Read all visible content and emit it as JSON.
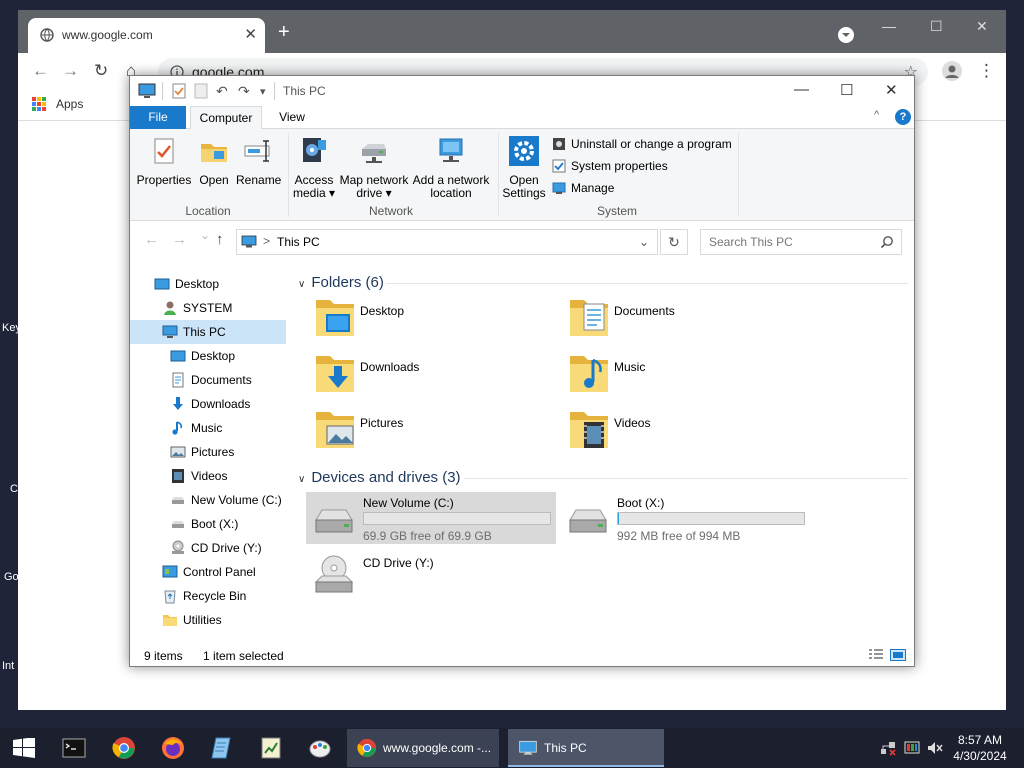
{
  "desktop": {
    "edge_labels": [
      "Key",
      "C",
      "Go",
      "Int"
    ]
  },
  "chrome": {
    "tab_title": "www.google.com",
    "close_tab": "✕",
    "new_tab": "+",
    "url": "google.com",
    "bookmark_apps": "Apps",
    "minimize": "—",
    "maximize": "☐",
    "close": "✕",
    "back": "←",
    "forward": "→",
    "reload": "↻",
    "home": "⌂",
    "star": "☆",
    "menu": "⋮"
  },
  "explorer": {
    "title": "This PC",
    "quick_undo": "↶",
    "quick_redo": "↷",
    "quick_dropdown": "▾",
    "minimize": "—",
    "maximize": "☐",
    "close": "✕",
    "tabs": {
      "file": "File",
      "computer": "Computer",
      "view": "View"
    },
    "ribbon_collapse": "^",
    "help": "?",
    "ribbon": {
      "location": {
        "label": "Location",
        "buttons": [
          "Properties",
          "Open",
          "Rename"
        ]
      },
      "network": {
        "label": "Network",
        "access_media": [
          "Access",
          "media ▾"
        ],
        "map_drive": [
          "Map network",
          "drive ▾"
        ],
        "add_location": [
          "Add a network",
          "location"
        ]
      },
      "system": {
        "label": "System",
        "open_settings": [
          "Open",
          "Settings"
        ],
        "uninstall": "Uninstall or change a program",
        "system_properties": "System properties",
        "manage": "Manage"
      }
    },
    "address": {
      "back": "←",
      "forward": "→",
      "recent": "⌄",
      "up": "↑",
      "separator": ">",
      "path": "This PC",
      "dropdown": "⌄",
      "refresh": "↻",
      "search_placeholder": "Search This PC"
    },
    "nav": [
      {
        "label": "Desktop",
        "icon": "desktop-icon"
      },
      {
        "label": "SYSTEM",
        "icon": "user-icon"
      },
      {
        "label": "This PC",
        "icon": "computer-icon",
        "selected": true
      },
      {
        "label": "Desktop",
        "icon": "desktop-icon"
      },
      {
        "label": "Documents",
        "icon": "documents-icon"
      },
      {
        "label": "Downloads",
        "icon": "downloads-icon"
      },
      {
        "label": "Music",
        "icon": "music-icon"
      },
      {
        "label": "Pictures",
        "icon": "pictures-icon"
      },
      {
        "label": "Videos",
        "icon": "videos-icon"
      },
      {
        "label": "New Volume (C:)",
        "icon": "drive-icon"
      },
      {
        "label": "Boot (X:)",
        "icon": "drive-icon"
      },
      {
        "label": "CD Drive (Y:)",
        "icon": "cd-drive-icon"
      },
      {
        "label": "Control Panel",
        "icon": "control-panel-icon"
      },
      {
        "label": "Recycle Bin",
        "icon": "recycle-bin-icon"
      },
      {
        "label": "Utilities",
        "icon": "folder-icon"
      }
    ],
    "folders_header": "Folders (6)",
    "folders": [
      {
        "label": "Desktop",
        "icon": "desktop-folder-icon"
      },
      {
        "label": "Documents",
        "icon": "documents-folder-icon"
      },
      {
        "label": "Downloads",
        "icon": "downloads-folder-icon"
      },
      {
        "label": "Music",
        "icon": "music-folder-icon"
      },
      {
        "label": "Pictures",
        "icon": "pictures-folder-icon"
      },
      {
        "label": "Videos",
        "icon": "videos-folder-icon"
      }
    ],
    "drives_header": "Devices and drives (3)",
    "drives": [
      {
        "label": "New Volume (C:)",
        "free": "69.9 GB free of 69.9 GB",
        "used_fraction": 0.0,
        "selected": true
      },
      {
        "label": "Boot (X:)",
        "free": "992 MB free of 994 MB",
        "used_fraction": 0.002
      },
      {
        "label": "CD Drive (Y:)"
      }
    ],
    "status": {
      "items": "9 items",
      "selected": "1 item selected"
    }
  },
  "taskbar": {
    "tasks": [
      {
        "label": "www.google.com -...",
        "icon": "chrome-icon"
      },
      {
        "label": "This PC",
        "icon": "explorer-icon"
      }
    ],
    "clock_time": "8:57 AM",
    "clock_date": "4/30/2024"
  },
  "colors": {
    "accent": "#1979ca",
    "folder": "#f3c94d",
    "selection": "#cce4f7",
    "taskbar": "#1c1f2e"
  }
}
